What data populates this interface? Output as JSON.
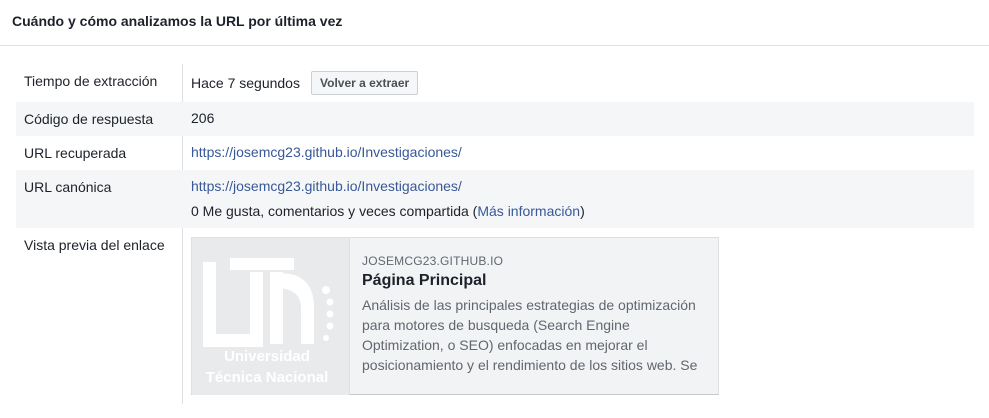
{
  "header": {
    "title": "Cuándo y cómo analizamos la URL por última vez"
  },
  "rows": {
    "extraction": {
      "label": "Tiempo de extracción",
      "value": "Hace 7 segundos",
      "button": "Volver a extraer"
    },
    "response": {
      "label": "Código de respuesta",
      "value": "206"
    },
    "fetched_url": {
      "label": "URL recuperada",
      "value": "https://josemcg23.github.io/Investigaciones/"
    },
    "canonical": {
      "label": "URL canónica",
      "value": "https://josemcg23.github.io/Investigaciones/",
      "stats": "0 Me gusta, comentarios y veces compartida",
      "stats_link": "Más información"
    },
    "preview": {
      "label": "Vista previa del enlace"
    }
  },
  "preview": {
    "logo_text": [
      "Universidad",
      "Técnica Nacional"
    ],
    "domain": "JOSEMCG23.GITHUB.IO",
    "title": "Página Principal",
    "description": "Análisis de las principales estrategias de optimización para motores de busqueda (Search Engine Optimization, o SEO) enfocadas en mejorar el posicionamiento y el rendimiento de los sitios web. Se"
  },
  "colors": {
    "link": "#385898",
    "shade": "#f5f6f7",
    "border": "#dddfe2"
  }
}
